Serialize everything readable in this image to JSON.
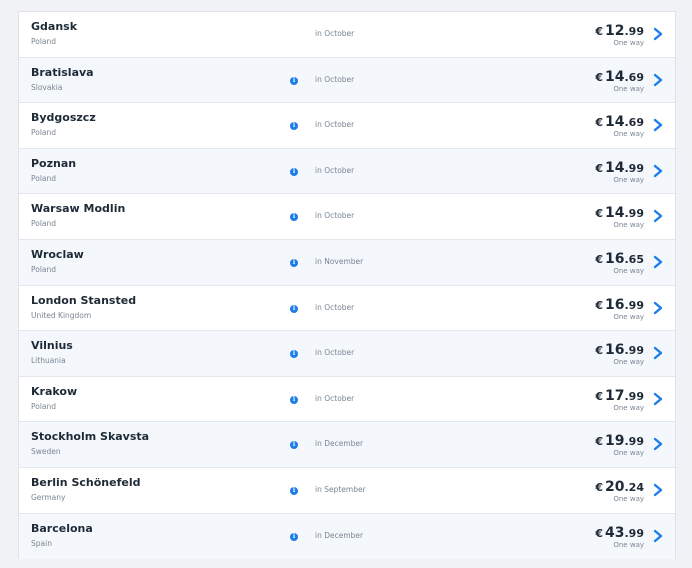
{
  "colors": {
    "accent": "#1e7ee8",
    "text": "#1f2a37",
    "muted": "#7a8593",
    "alt_row": "#f4f8fc"
  },
  "flights": [
    {
      "city": "Gdansk",
      "country": "Poland",
      "info": false,
      "when": "in October",
      "currency": "€",
      "whole": "12",
      "decimal": ".99",
      "trip": "One way"
    },
    {
      "city": "Bratislava",
      "country": "Slovakia",
      "info": true,
      "when": "in October",
      "currency": "€",
      "whole": "14",
      "decimal": ".69",
      "trip": "One way"
    },
    {
      "city": "Bydgoszcz",
      "country": "Poland",
      "info": true,
      "when": "in October",
      "currency": "€",
      "whole": "14",
      "decimal": ".69",
      "trip": "One way"
    },
    {
      "city": "Poznan",
      "country": "Poland",
      "info": true,
      "when": "in October",
      "currency": "€",
      "whole": "14",
      "decimal": ".99",
      "trip": "One way"
    },
    {
      "city": "Warsaw Modlin",
      "country": "Poland",
      "info": true,
      "when": "in October",
      "currency": "€",
      "whole": "14",
      "decimal": ".99",
      "trip": "One way"
    },
    {
      "city": "Wroclaw",
      "country": "Poland",
      "info": true,
      "when": "in November",
      "currency": "€",
      "whole": "16",
      "decimal": ".65",
      "trip": "One way"
    },
    {
      "city": "London Stansted",
      "country": "United Kingdom",
      "info": true,
      "when": "in October",
      "currency": "€",
      "whole": "16",
      "decimal": ".99",
      "trip": "One way"
    },
    {
      "city": "Vilnius",
      "country": "Lithuania",
      "info": true,
      "when": "in October",
      "currency": "€",
      "whole": "16",
      "decimal": ".99",
      "trip": "One way"
    },
    {
      "city": "Krakow",
      "country": "Poland",
      "info": true,
      "when": "in October",
      "currency": "€",
      "whole": "17",
      "decimal": ".99",
      "trip": "One way"
    },
    {
      "city": "Stockholm Skavsta",
      "country": "Sweden",
      "info": true,
      "when": "in December",
      "currency": "€",
      "whole": "19",
      "decimal": ".99",
      "trip": "One way"
    },
    {
      "city": "Berlin Schönefeld",
      "country": "Germany",
      "info": true,
      "when": "in September",
      "currency": "€",
      "whole": "20",
      "decimal": ".24",
      "trip": "One way"
    },
    {
      "city": "Barcelona",
      "country": "Spain",
      "info": true,
      "when": "in December",
      "currency": "€",
      "whole": "43",
      "decimal": ".99",
      "trip": "One way"
    }
  ]
}
